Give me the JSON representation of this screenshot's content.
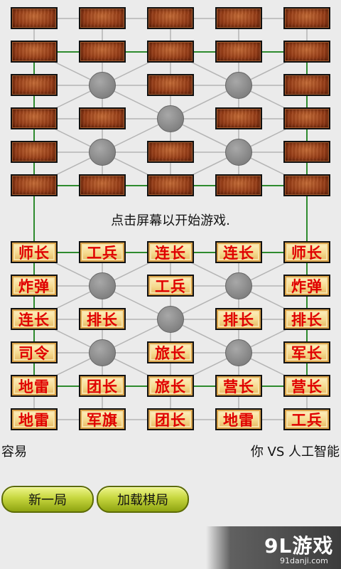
{
  "board": {
    "enemy_rows_hidden": 6,
    "player_pieces": [
      [
        "师长",
        "工兵",
        "连长",
        "连长",
        "师长"
      ],
      [
        "炸弹",
        null,
        "工兵",
        null,
        "炸弹"
      ],
      [
        "连长",
        "排长",
        null,
        "排长",
        "排长"
      ],
      [
        "司令",
        null,
        "旅长",
        null,
        "军长"
      ],
      [
        "地雷",
        "团长",
        "旅长",
        "营长",
        "营长"
      ],
      [
        "地雷",
        "军旗",
        "团长",
        "地雷",
        "工兵"
      ]
    ]
  },
  "status": {
    "prompt": "点击屏幕以开始游戏."
  },
  "footer": {
    "difficulty": "容易",
    "versus": "你 VS 人工智能"
  },
  "buttons": {
    "new_game": "新一局",
    "load_game": "加载棋局"
  },
  "watermark": {
    "logo": "9L游戏",
    "url": "91danji.com"
  },
  "colors": {
    "piece_text": "#e00000",
    "railway_line": "#2e8b2e",
    "road_line": "#b4b4b4",
    "camp": "#8c8c8c",
    "button": "#c6d63e"
  }
}
